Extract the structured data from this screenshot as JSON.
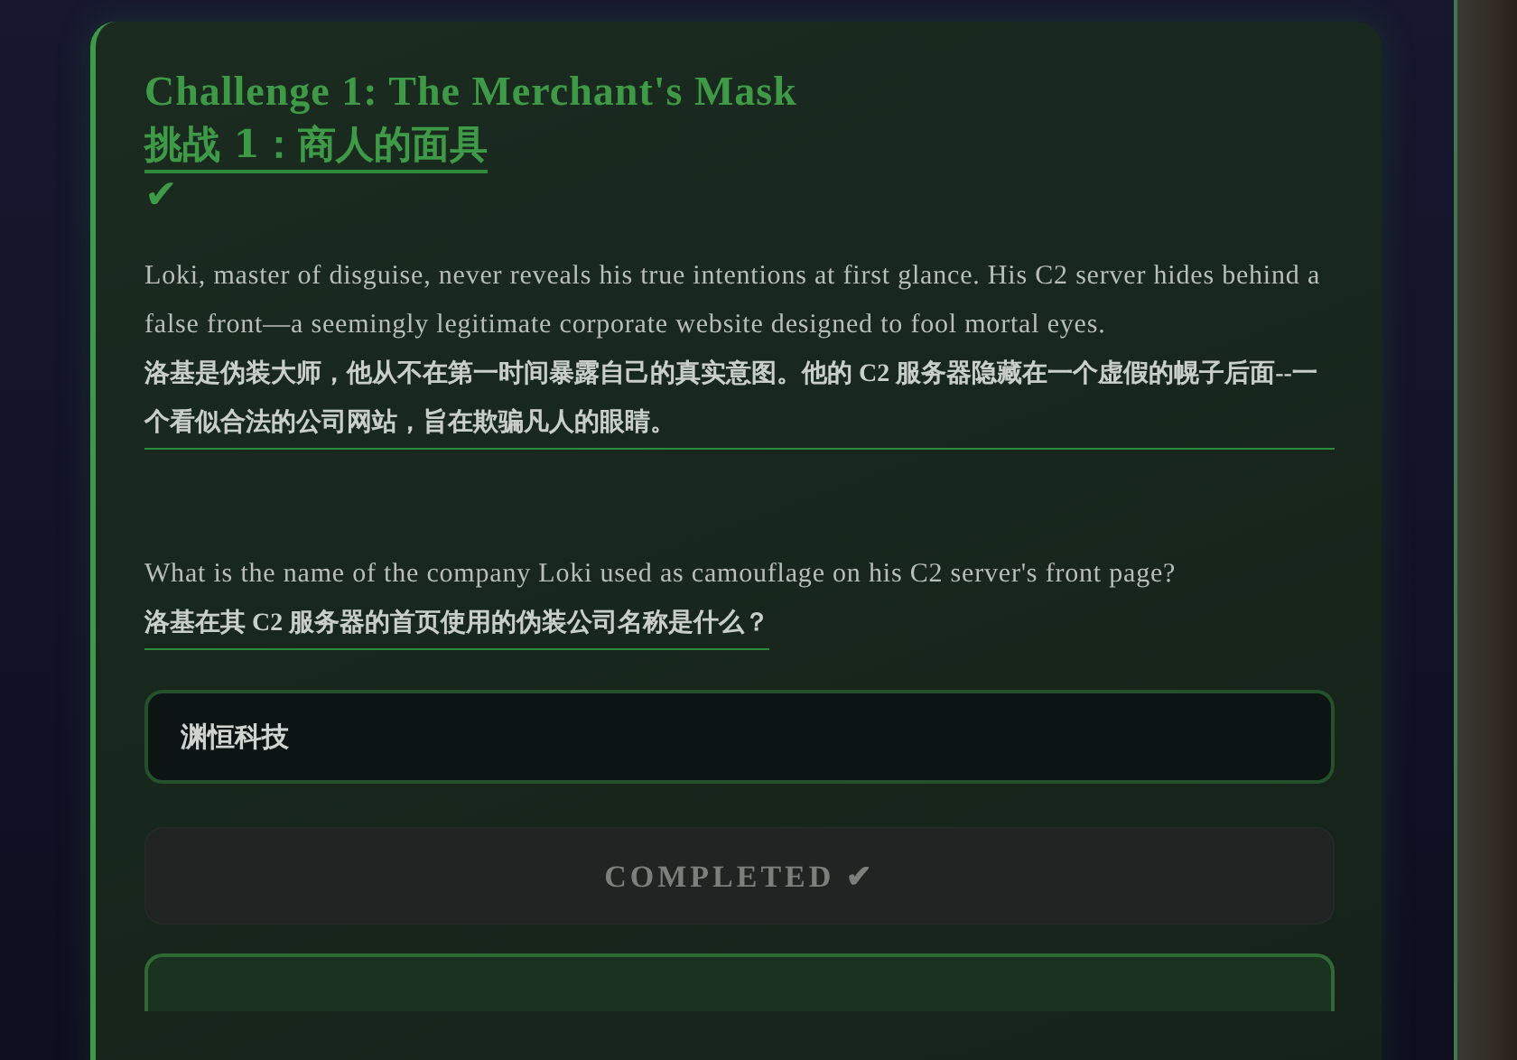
{
  "challenge": {
    "title": "Challenge 1: The Merchant's Mask",
    "title_zh": "挑战 1：商人的面具",
    "status_mark": "✔",
    "completed": true,
    "story": "Loki, master of disguise, never reveals his true intentions at first glance. His C2 server hides behind a false front—a seemingly legitimate corporate website designed to fool mortal eyes.",
    "story_zh": "洛基是伪装大师，他从不在第一时间暴露自己的真实意图。他的 C2 服务器隐藏在一个虚假的幌子后面--一个看似合法的公司网站，旨在欺骗凡人的眼睛。",
    "question": "What is the name of the company Loki used as camouflage on his C2 server's front page?",
    "question_zh": "洛基在其 C2 服务器的首页使用的伪装公司名称是什么？",
    "answer": "渊恒科技",
    "button": {
      "label": "COMPLETED ✔",
      "disabled": true
    }
  }
}
